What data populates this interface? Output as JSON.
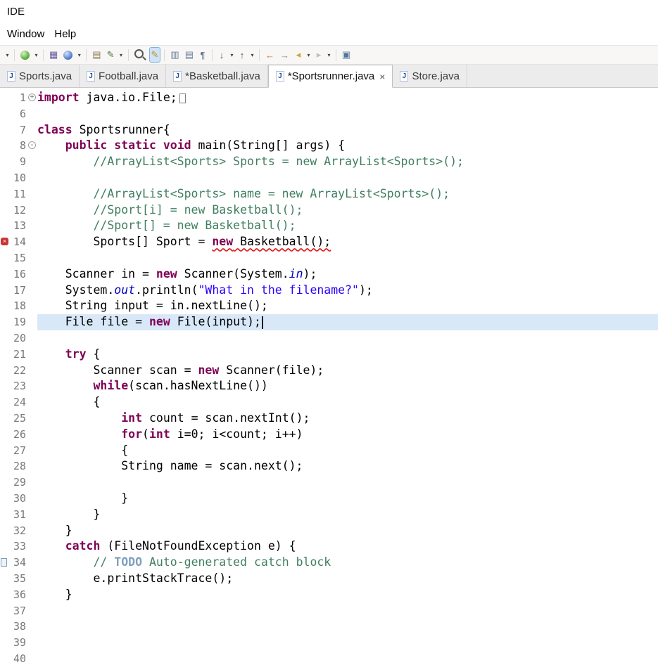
{
  "window": {
    "title": "IDE"
  },
  "menubar": {
    "items": [
      "Window",
      "Help"
    ]
  },
  "toolbar": {
    "groups": [
      {
        "items": [
          {
            "name": "quick-access-dropdown",
            "kind": "arrow"
          }
        ]
      },
      {
        "items": [
          {
            "name": "run-button",
            "kind": "ball-green"
          },
          {
            "name": "run-dropdown",
            "kind": "arrow"
          }
        ]
      },
      {
        "items": [
          {
            "name": "new-java-project-button",
            "kind": "glyph",
            "glyph": "▦",
            "color": "#6a5a9e"
          },
          {
            "name": "debug-button",
            "kind": "ball-blue"
          },
          {
            "name": "debug-dropdown",
            "kind": "arrow"
          }
        ]
      },
      {
        "items": [
          {
            "name": "print-button",
            "kind": "glyph",
            "glyph": "▤",
            "color": "#8a7a5a"
          },
          {
            "name": "external-tools-button",
            "kind": "glyph",
            "glyph": "✎",
            "color": "#4a7a3a"
          },
          {
            "name": "external-tools-dropdown",
            "kind": "arrow"
          }
        ]
      },
      {
        "items": [
          {
            "name": "java-search-button",
            "kind": "mag"
          },
          {
            "name": "mark-occurrences-toggle",
            "kind": "glyph",
            "glyph": "✎",
            "color": "#c09020",
            "active": true
          }
        ]
      },
      {
        "items": [
          {
            "name": "show-whitespace-button",
            "kind": "glyph",
            "glyph": "▥",
            "color": "#6b7c9a"
          },
          {
            "name": "show-source-button",
            "kind": "glyph",
            "glyph": "▤",
            "color": "#6b7c9a"
          },
          {
            "name": "pilcrow-button",
            "kind": "glyph",
            "glyph": "¶",
            "color": "#5a6a8a"
          }
        ]
      },
      {
        "items": [
          {
            "name": "next-annotation-button",
            "kind": "glyph",
            "glyph": "↓",
            "color": "#555555"
          },
          {
            "name": "next-annotation-dropdown",
            "kind": "arrow"
          },
          {
            "name": "prev-annotation-button",
            "kind": "glyph",
            "glyph": "↑",
            "color": "#555555"
          },
          {
            "name": "prev-annotation-dropdown",
            "kind": "arrow"
          }
        ]
      },
      {
        "items": [
          {
            "name": "last-edit-location-button",
            "kind": "glyph",
            "glyph": "←",
            "color": "#b08030"
          },
          {
            "name": "previous-edit-location-button",
            "kind": "glyph",
            "glyph": "→",
            "color": "#888888"
          },
          {
            "name": "back-button",
            "kind": "glyph",
            "glyph": "◂",
            "color": "#caa53c"
          },
          {
            "name": "back-dropdown",
            "kind": "arrow"
          },
          {
            "name": "forward-button",
            "kind": "glyph",
            "glyph": "▸",
            "color": "#bbbbbb",
            "disabled": true
          },
          {
            "name": "forward-dropdown",
            "kind": "arrow"
          }
        ]
      },
      {
        "items": [
          {
            "name": "new-editor-window-button",
            "kind": "glyph",
            "glyph": "▣",
            "color": "#557799"
          }
        ]
      }
    ]
  },
  "tabs": [
    {
      "label": "Sports.java",
      "active": false
    },
    {
      "label": "Football.java",
      "active": false
    },
    {
      "label": "*Basketball.java",
      "active": false
    },
    {
      "label": "*Sportsrunner.java",
      "active": true,
      "close_glyph": "×"
    },
    {
      "label": "Store.java",
      "active": false
    }
  ],
  "editor": {
    "current_line": "19",
    "lines": [
      {
        "n": "1",
        "fold": "+",
        "tokens": [
          [
            "k",
            "import"
          ],
          [
            "p",
            " java.io.File;"
          ],
          [
            "box",
            ""
          ]
        ]
      },
      {
        "n": "6",
        "tokens": []
      },
      {
        "n": "7",
        "tokens": [
          [
            "k",
            "class"
          ],
          [
            "p",
            " Sportsrunner{"
          ]
        ]
      },
      {
        "n": "8",
        "fold": "-",
        "tokens": [
          [
            "p",
            "    "
          ],
          [
            "k",
            "public"
          ],
          [
            "p",
            " "
          ],
          [
            "k",
            "static"
          ],
          [
            "p",
            " "
          ],
          [
            "k",
            "void"
          ],
          [
            "p",
            " main(String[] args) {"
          ]
        ]
      },
      {
        "n": "9",
        "tokens": [
          [
            "c",
            "        //ArrayList<Sports> Sports = new ArrayList<Sports>();"
          ]
        ]
      },
      {
        "n": "10",
        "tokens": []
      },
      {
        "n": "11",
        "tokens": [
          [
            "c",
            "        //ArrayList<Sports> name = new ArrayList<Sports>();"
          ]
        ]
      },
      {
        "n": "12",
        "tokens": [
          [
            "c",
            "        //Sport[i] = new Basketball();"
          ]
        ]
      },
      {
        "n": "13",
        "tokens": [
          [
            "c",
            "        //Sport[] = new Basketball();"
          ]
        ]
      },
      {
        "n": "14",
        "marker": "error",
        "tokens": [
          [
            "p",
            "        Sports[] Sport = "
          ],
          [
            "k",
            "new",
            1
          ],
          [
            "p",
            " Basketball();",
            1
          ]
        ]
      },
      {
        "n": "15",
        "tokens": []
      },
      {
        "n": "16",
        "tokens": [
          [
            "p",
            "    Scanner in = "
          ],
          [
            "k",
            "new"
          ],
          [
            "p",
            " Scanner(System."
          ],
          [
            "f",
            "in"
          ],
          [
            "p",
            ");"
          ]
        ]
      },
      {
        "n": "17",
        "tokens": [
          [
            "p",
            "    System."
          ],
          [
            "f",
            "out"
          ],
          [
            "p",
            ".println("
          ],
          [
            "s",
            "\"What in the filename?\""
          ],
          [
            "p",
            ");"
          ]
        ]
      },
      {
        "n": "18",
        "tokens": [
          [
            "p",
            "    String input = in.nextLine();"
          ]
        ]
      },
      {
        "n": "19",
        "cursor": true,
        "tokens": [
          [
            "p",
            "    File file = "
          ],
          [
            "k",
            "new"
          ],
          [
            "p",
            " File(input);"
          ]
        ]
      },
      {
        "n": "20",
        "tokens": []
      },
      {
        "n": "21",
        "tokens": [
          [
            "p",
            "    "
          ],
          [
            "k",
            "try"
          ],
          [
            "p",
            " {"
          ]
        ]
      },
      {
        "n": "22",
        "tokens": [
          [
            "p",
            "        Scanner scan = "
          ],
          [
            "k",
            "new"
          ],
          [
            "p",
            " Scanner(file);"
          ]
        ]
      },
      {
        "n": "23",
        "tokens": [
          [
            "p",
            "        "
          ],
          [
            "k",
            "while"
          ],
          [
            "p",
            "(scan.hasNextLine())"
          ]
        ]
      },
      {
        "n": "24",
        "tokens": [
          [
            "p",
            "        {"
          ]
        ]
      },
      {
        "n": "25",
        "tokens": [
          [
            "p",
            "            "
          ],
          [
            "k",
            "int"
          ],
          [
            "p",
            " count = scan.nextInt();"
          ]
        ]
      },
      {
        "n": "26",
        "tokens": [
          [
            "p",
            "            "
          ],
          [
            "k",
            "for"
          ],
          [
            "p",
            "("
          ],
          [
            "k",
            "int"
          ],
          [
            "p",
            " i=0; i<count; i++)"
          ]
        ]
      },
      {
        "n": "27",
        "tokens": [
          [
            "p",
            "            {"
          ]
        ]
      },
      {
        "n": "28",
        "tokens": [
          [
            "p",
            "            String name = scan.next();"
          ]
        ]
      },
      {
        "n": "29",
        "tokens": []
      },
      {
        "n": "30",
        "tokens": [
          [
            "p",
            "            }"
          ]
        ]
      },
      {
        "n": "31",
        "tokens": [
          [
            "p",
            "        }"
          ]
        ]
      },
      {
        "n": "32",
        "tokens": [
          [
            "p",
            "    }"
          ]
        ]
      },
      {
        "n": "33",
        "tokens": [
          [
            "p",
            "    "
          ],
          [
            "k",
            "catch"
          ],
          [
            "p",
            " (FileNotFoundException e) {"
          ]
        ]
      },
      {
        "n": "34",
        "marker": "task",
        "tokens": [
          [
            "c",
            "        // "
          ],
          [
            "t",
            "TODO"
          ],
          [
            "c",
            " Auto-generated catch block"
          ]
        ]
      },
      {
        "n": "35",
        "tokens": [
          [
            "p",
            "        e.printStackTrace();"
          ]
        ]
      },
      {
        "n": "36",
        "tokens": [
          [
            "p",
            "    }"
          ]
        ]
      },
      {
        "n": "37",
        "tokens": []
      },
      {
        "n": "38",
        "tokens": []
      },
      {
        "n": "39",
        "tokens": []
      },
      {
        "n": "40",
        "tokens": []
      }
    ]
  },
  "colors": {
    "keyword": "#7f0055",
    "comment": "#3f7f5f",
    "string": "#2a00ff",
    "static_field": "#0000c0",
    "task_tag": "#7f9fbf",
    "line_number": "#787878",
    "current_line_bg": "#d9e8f8",
    "error_red": "#e01414",
    "tab_bar_bg": "#ececec",
    "active_tab_bg": "#ffffff"
  }
}
